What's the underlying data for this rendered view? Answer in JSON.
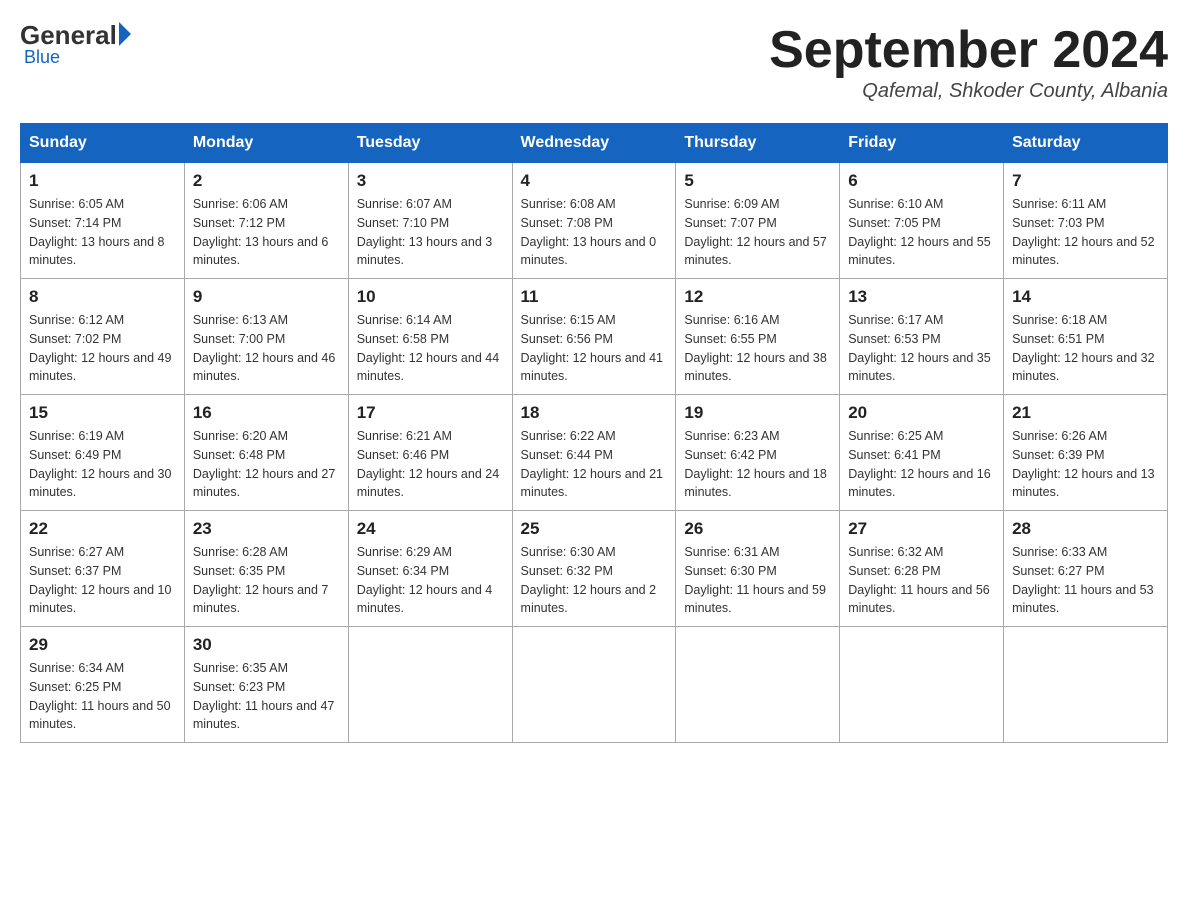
{
  "logo": {
    "general": "General",
    "blue": "Blue",
    "subtitle": "Blue"
  },
  "header": {
    "month_year": "September 2024",
    "location": "Qafemal, Shkoder County, Albania"
  },
  "days_of_week": [
    "Sunday",
    "Monday",
    "Tuesday",
    "Wednesday",
    "Thursday",
    "Friday",
    "Saturday"
  ],
  "weeks": [
    [
      {
        "day": "1",
        "sunrise": "6:05 AM",
        "sunset": "7:14 PM",
        "daylight": "13 hours and 8 minutes."
      },
      {
        "day": "2",
        "sunrise": "6:06 AM",
        "sunset": "7:12 PM",
        "daylight": "13 hours and 6 minutes."
      },
      {
        "day": "3",
        "sunrise": "6:07 AM",
        "sunset": "7:10 PM",
        "daylight": "13 hours and 3 minutes."
      },
      {
        "day": "4",
        "sunrise": "6:08 AM",
        "sunset": "7:08 PM",
        "daylight": "13 hours and 0 minutes."
      },
      {
        "day": "5",
        "sunrise": "6:09 AM",
        "sunset": "7:07 PM",
        "daylight": "12 hours and 57 minutes."
      },
      {
        "day": "6",
        "sunrise": "6:10 AM",
        "sunset": "7:05 PM",
        "daylight": "12 hours and 55 minutes."
      },
      {
        "day": "7",
        "sunrise": "6:11 AM",
        "sunset": "7:03 PM",
        "daylight": "12 hours and 52 minutes."
      }
    ],
    [
      {
        "day": "8",
        "sunrise": "6:12 AM",
        "sunset": "7:02 PM",
        "daylight": "12 hours and 49 minutes."
      },
      {
        "day": "9",
        "sunrise": "6:13 AM",
        "sunset": "7:00 PM",
        "daylight": "12 hours and 46 minutes."
      },
      {
        "day": "10",
        "sunrise": "6:14 AM",
        "sunset": "6:58 PM",
        "daylight": "12 hours and 44 minutes."
      },
      {
        "day": "11",
        "sunrise": "6:15 AM",
        "sunset": "6:56 PM",
        "daylight": "12 hours and 41 minutes."
      },
      {
        "day": "12",
        "sunrise": "6:16 AM",
        "sunset": "6:55 PM",
        "daylight": "12 hours and 38 minutes."
      },
      {
        "day": "13",
        "sunrise": "6:17 AM",
        "sunset": "6:53 PM",
        "daylight": "12 hours and 35 minutes."
      },
      {
        "day": "14",
        "sunrise": "6:18 AM",
        "sunset": "6:51 PM",
        "daylight": "12 hours and 32 minutes."
      }
    ],
    [
      {
        "day": "15",
        "sunrise": "6:19 AM",
        "sunset": "6:49 PM",
        "daylight": "12 hours and 30 minutes."
      },
      {
        "day": "16",
        "sunrise": "6:20 AM",
        "sunset": "6:48 PM",
        "daylight": "12 hours and 27 minutes."
      },
      {
        "day": "17",
        "sunrise": "6:21 AM",
        "sunset": "6:46 PM",
        "daylight": "12 hours and 24 minutes."
      },
      {
        "day": "18",
        "sunrise": "6:22 AM",
        "sunset": "6:44 PM",
        "daylight": "12 hours and 21 minutes."
      },
      {
        "day": "19",
        "sunrise": "6:23 AM",
        "sunset": "6:42 PM",
        "daylight": "12 hours and 18 minutes."
      },
      {
        "day": "20",
        "sunrise": "6:25 AM",
        "sunset": "6:41 PM",
        "daylight": "12 hours and 16 minutes."
      },
      {
        "day": "21",
        "sunrise": "6:26 AM",
        "sunset": "6:39 PM",
        "daylight": "12 hours and 13 minutes."
      }
    ],
    [
      {
        "day": "22",
        "sunrise": "6:27 AM",
        "sunset": "6:37 PM",
        "daylight": "12 hours and 10 minutes."
      },
      {
        "day": "23",
        "sunrise": "6:28 AM",
        "sunset": "6:35 PM",
        "daylight": "12 hours and 7 minutes."
      },
      {
        "day": "24",
        "sunrise": "6:29 AM",
        "sunset": "6:34 PM",
        "daylight": "12 hours and 4 minutes."
      },
      {
        "day": "25",
        "sunrise": "6:30 AM",
        "sunset": "6:32 PM",
        "daylight": "12 hours and 2 minutes."
      },
      {
        "day": "26",
        "sunrise": "6:31 AM",
        "sunset": "6:30 PM",
        "daylight": "11 hours and 59 minutes."
      },
      {
        "day": "27",
        "sunrise": "6:32 AM",
        "sunset": "6:28 PM",
        "daylight": "11 hours and 56 minutes."
      },
      {
        "day": "28",
        "sunrise": "6:33 AM",
        "sunset": "6:27 PM",
        "daylight": "11 hours and 53 minutes."
      }
    ],
    [
      {
        "day": "29",
        "sunrise": "6:34 AM",
        "sunset": "6:25 PM",
        "daylight": "11 hours and 50 minutes."
      },
      {
        "day": "30",
        "sunrise": "6:35 AM",
        "sunset": "6:23 PM",
        "daylight": "11 hours and 47 minutes."
      },
      null,
      null,
      null,
      null,
      null
    ]
  ],
  "labels": {
    "sunrise": "Sunrise:",
    "sunset": "Sunset:",
    "daylight": "Daylight:"
  }
}
